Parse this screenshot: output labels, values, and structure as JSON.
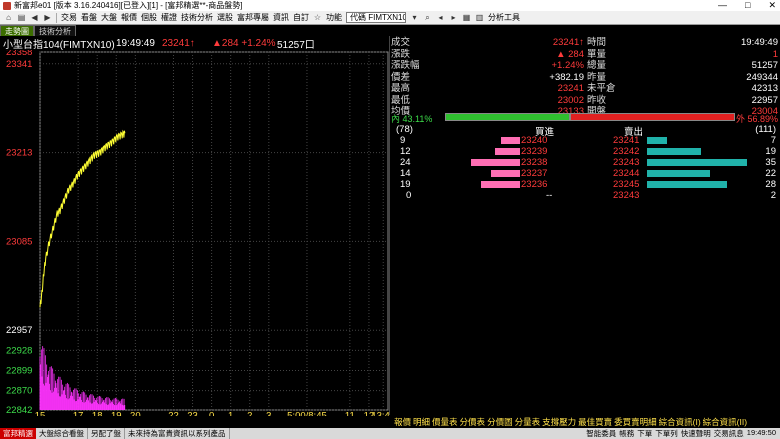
{
  "window": {
    "title": "新富邦e01 [版本 3.16.240416][已登入][1] - [富邦精選**-商品盤勢]",
    "minimize": "—",
    "maximize": "□",
    "close": "✕"
  },
  "toolbar": {
    "menus": [
      "交易",
      "看盤",
      "大盤",
      "報價",
      "個股",
      "權證",
      "技術分析",
      "選股",
      "富邦專屬",
      "資訊",
      "自訂",
      "功能"
    ],
    "code_field": "代碼 FIMTXN10.TF",
    "analysis_label": "分析工具"
  },
  "tabs": [
    "走勢圖",
    "技術分析"
  ],
  "chart_header": {
    "symbol": "小型台指104(FIMTXN10)",
    "time": "19:49:49",
    "price": "23241↑",
    "change": "▲284 +1.24%",
    "volume": "51257口"
  },
  "chart_data": {
    "type": "line",
    "price_axis": {
      "labels": [
        "23358",
        "23341",
        "23213",
        "23085",
        "22957",
        "22928",
        "22899",
        "22870",
        "22842"
      ],
      "values": [
        23358,
        23341,
        23213,
        23085,
        22957,
        22928,
        22899,
        22870,
        22842
      ],
      "colors": [
        "#ff3b3b",
        "#ff3b3b",
        "#ff3b3b",
        "#ff3b3b",
        "#ffffff",
        "#3ddc4a",
        "#3ddc4a",
        "#3ddc4a",
        "#3ddc4a"
      ]
    },
    "ylim": [
      22842,
      23358
    ],
    "reference": 22957,
    "x_ticks": [
      "15",
      "17",
      "18",
      "19",
      "20",
      "22",
      "23",
      "0",
      "1",
      "2",
      "3",
      "5:00/8:45",
      "11",
      "12",
      "13:45"
    ],
    "x_tick_positions": [
      0,
      2,
      3,
      4,
      5,
      7,
      8,
      9,
      10,
      11,
      12,
      14,
      16.25,
      17.25,
      18
    ],
    "x_range": [
      0,
      18.25
    ],
    "price_series": [
      [
        0.0,
        22990
      ],
      [
        0.1,
        23010
      ],
      [
        0.2,
        23040
      ],
      [
        0.3,
        23060
      ],
      [
        0.45,
        23080
      ],
      [
        0.6,
        23095
      ],
      [
        0.75,
        23110
      ],
      [
        0.9,
        23125
      ],
      [
        1.05,
        23130
      ],
      [
        1.2,
        23140
      ],
      [
        1.35,
        23150
      ],
      [
        1.5,
        23160
      ],
      [
        1.65,
        23165
      ],
      [
        1.8,
        23172
      ],
      [
        1.95,
        23180
      ],
      [
        2.1,
        23185
      ],
      [
        2.25,
        23190
      ],
      [
        2.4,
        23195
      ],
      [
        2.55,
        23200
      ],
      [
        2.7,
        23205
      ],
      [
        2.85,
        23210
      ],
      [
        3.0,
        23212
      ],
      [
        3.15,
        23214
      ],
      [
        3.3,
        23218
      ],
      [
        3.45,
        23222
      ],
      [
        3.6,
        23225
      ],
      [
        3.75,
        23228
      ],
      [
        3.9,
        23232
      ],
      [
        4.05,
        23236
      ],
      [
        4.2,
        23238
      ],
      [
        4.35,
        23240
      ],
      [
        4.45,
        23241
      ]
    ],
    "volume_profile": [
      [
        0.0,
        0.95
      ],
      [
        0.3,
        0.7
      ],
      [
        0.6,
        0.55
      ],
      [
        0.9,
        0.45
      ],
      [
        1.2,
        0.38
      ],
      [
        1.5,
        0.33
      ],
      [
        1.8,
        0.28
      ],
      [
        2.1,
        0.25
      ],
      [
        2.4,
        0.22
      ],
      [
        2.7,
        0.2
      ],
      [
        3.0,
        0.18
      ],
      [
        3.3,
        0.17
      ],
      [
        3.6,
        0.16
      ],
      [
        3.9,
        0.15
      ],
      [
        4.2,
        0.15
      ],
      [
        4.45,
        0.14
      ]
    ],
    "colors": {
      "line": "#ffff33",
      "volume": "#ff33ff",
      "grid": "#444444",
      "axis": "#888888"
    }
  },
  "quote": {
    "rows": [
      {
        "l1": "成交",
        "v1": "23241↑",
        "c1": "red",
        "l2": "時間",
        "v2": "19:49:49",
        "c2": "white"
      },
      {
        "l1": "漲跌",
        "v1": "▲ 284",
        "c1": "red",
        "l2": "單量",
        "v2": "1",
        "c2": "red"
      },
      {
        "l1": "漲跌幅",
        "v1": "+1.24%",
        "c1": "red",
        "l2": "總量",
        "v2": "51257",
        "c2": "white"
      },
      {
        "l1": "價差",
        "v1": "+382.19",
        "c1": "white",
        "l2": "昨量",
        "v2": "249344",
        "c2": "white"
      },
      {
        "l1": "最高",
        "v1": "23241",
        "c1": "red",
        "l2": "未平倉",
        "v2": "42313",
        "c2": "white"
      },
      {
        "l1": "最低",
        "v1": "23002",
        "c1": "red",
        "l2": "昨收",
        "v2": "22957",
        "c2": "white"
      },
      {
        "l1": "均價",
        "v1": "23133",
        "c1": "red",
        "l2": "開盤",
        "v2": "23004",
        "c2": "red"
      }
    ]
  },
  "ratio": {
    "inside_label": "內 43.11%",
    "outside_label": "外 56.89%",
    "inside_fraction": 0.4311
  },
  "book": {
    "bid_total": "(78)",
    "bid_header": "買進",
    "ask_header": "賣出",
    "ask_total": "(111)",
    "rows": [
      {
        "bq": "9",
        "bp": "23240",
        "ap": "23241",
        "aq": "7",
        "bqv": 9,
        "aqv": 7
      },
      {
        "bq": "12",
        "bp": "23239",
        "ap": "23242",
        "aq": "19",
        "bqv": 12,
        "aqv": 19
      },
      {
        "bq": "24",
        "bp": "23238",
        "ap": "23243",
        "aq": "35",
        "bqv": 24,
        "aqv": 35
      },
      {
        "bq": "14",
        "bp": "23237",
        "ap": "23244",
        "aq": "22",
        "bqv": 14,
        "aqv": 22
      },
      {
        "bq": "19",
        "bp": "23236",
        "ap": "23245",
        "aq": "28",
        "bqv": 19,
        "aqv": 28
      }
    ],
    "summary": {
      "left": "0",
      "mid": "--",
      "price": "23243",
      "right": "2"
    }
  },
  "bottom_tabs": [
    "報價",
    "明細",
    "價量表",
    "分價表",
    "分價圖",
    "分量表",
    "支撐壓力",
    "最佳買賣",
    "委買賣明細",
    "綜合資訊(I)",
    "綜合資訊(II)"
  ],
  "statusbar": {
    "button": "富邦精選",
    "items": [
      "大盤綜合看盤",
      "另配了盤",
      "未來持為富貴資訊以系列產品"
    ],
    "right": [
      "智能委員",
      "帳務",
      "下單",
      "下單列",
      "快速聲明",
      "交易訊息",
      "19:49:50"
    ]
  }
}
